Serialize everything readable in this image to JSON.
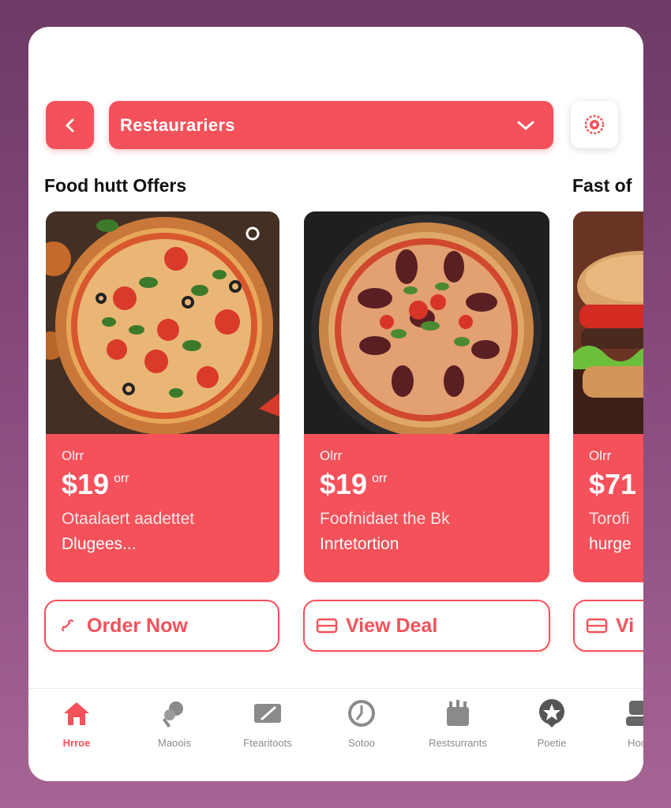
{
  "header": {
    "back_icon": "chevron-left-icon",
    "dropdown_label": "Restaurariers",
    "dropdown_icon": "chevron-down-icon",
    "filter_icon": "target-icon"
  },
  "sections": [
    {
      "title": "Food hutt Offers"
    },
    {
      "title": "Fast of"
    }
  ],
  "cards": [
    {
      "tag": "Olrr",
      "price": "$19",
      "price_suffix": "orr",
      "line1": "Otaalaert aadettet",
      "line2": "Dlugees...",
      "image": "pizza-vegetable-photo",
      "button_label": "Order Now",
      "button_icon": "phone-icon"
    },
    {
      "tag": "Olrr",
      "price": "$19",
      "price_suffix": "orr",
      "line1": "Foofnidaet the Bk",
      "line2": "Inrtetortion",
      "image": "pizza-pepperoni-photo",
      "button_label": "View Deal",
      "button_icon": "ticket-icon"
    },
    {
      "tag": "Olrr",
      "price": "$71",
      "price_suffix": "",
      "line1": "Torofi",
      "line2": "hurge",
      "image": "burger-photo",
      "button_label": "Vi",
      "button_icon": "ticket-icon"
    }
  ],
  "tabs": [
    {
      "label": "Hrroe",
      "icon": "home-icon",
      "active": true
    },
    {
      "label": "Maoois",
      "icon": "food-icon"
    },
    {
      "label": "Ftearitoots",
      "icon": "deals-icon"
    },
    {
      "label": "Sotoo",
      "icon": "clock-icon"
    },
    {
      "label": "Restsurrants",
      "icon": "store-icon"
    },
    {
      "label": "Poetie",
      "icon": "profile-icon"
    },
    {
      "label": "Hoo",
      "icon": "more-icon"
    }
  ],
  "colors": {
    "accent": "#f4515a",
    "background": "#7b4272",
    "surface": "#ffffff",
    "tab_inactive": "#8a8a8a"
  }
}
